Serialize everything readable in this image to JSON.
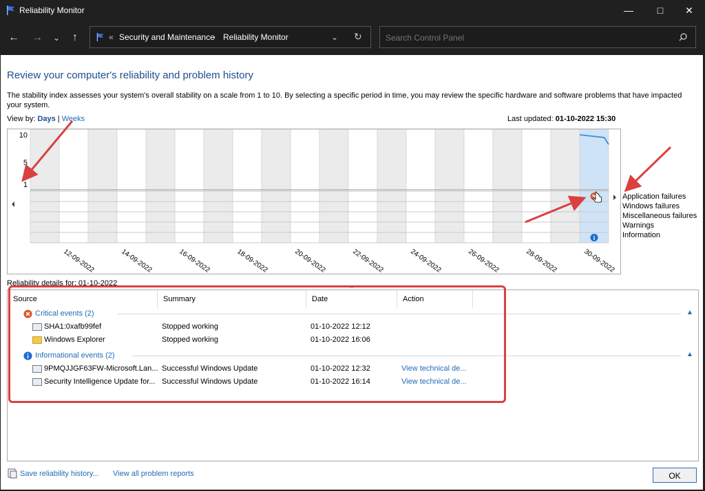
{
  "window": {
    "title": "Reliability Monitor"
  },
  "address": {
    "prefix": "«",
    "crumbs": [
      "Security and Maintenance",
      "Reliability Monitor"
    ]
  },
  "search": {
    "placeholder": "Search Control Panel"
  },
  "page": {
    "heading": "Review your computer's reliability and problem history",
    "description": "The stability index assesses your system's overall stability on a scale from 1 to 10. By selecting a specific period in time, you may review the specific hardware and software problems that have impacted your system.",
    "view_by_label": "View by:",
    "view_days": "Days",
    "view_separator": "|",
    "view_weeks": "Weeks",
    "last_updated_label": "Last updated:",
    "last_updated_value": "01-10-2022 15:30"
  },
  "chart_data": {
    "type": "line",
    "y_ticks": [
      "10",
      "5",
      "1"
    ],
    "ylim": [
      1,
      10
    ],
    "dates": [
      "12-09-2022",
      "14-09-2022",
      "16-09-2022",
      "18-09-2022",
      "20-09-2022",
      "22-09-2022",
      "24-09-2022",
      "26-09-2022",
      "28-09-2022",
      "30-09-2022"
    ],
    "stability_index": {
      "x": [
        "01-10-2022",
        "01-10-2022"
      ],
      "y": [
        10,
        9.5
      ]
    },
    "selected_day": "01-10-2022",
    "events": [
      {
        "day": "01-10-2022",
        "category": "Application failures",
        "kind": "critical"
      },
      {
        "day": "01-10-2022",
        "category": "Information",
        "kind": "info"
      }
    ],
    "grid": true
  },
  "legend": [
    "Application failures",
    "Windows failures",
    "Miscellaneous failures",
    "Warnings",
    "Information"
  ],
  "details": {
    "label": "Reliability details for: 01-10-2022",
    "columns": [
      "Source",
      "Summary",
      "Date",
      "Action"
    ],
    "groups": [
      {
        "title": "Critical events (2)",
        "rows": [
          {
            "source": "SHA1:0xafb99fef",
            "summary": "Stopped working",
            "date": "01-10-2022 12:12",
            "action": ""
          },
          {
            "source": "Windows Explorer",
            "summary": "Stopped working",
            "date": "01-10-2022 16:06",
            "action": ""
          }
        ]
      },
      {
        "title": "Informational events (2)",
        "rows": [
          {
            "source": "9PMQJJGF63FW-Microsoft.Lan...",
            "summary": "Successful Windows Update",
            "date": "01-10-2022 12:32",
            "action": "View technical de..."
          },
          {
            "source": "Security Intelligence Update for...",
            "summary": "Successful Windows Update",
            "date": "01-10-2022 16:14",
            "action": "View technical de..."
          }
        ]
      }
    ]
  },
  "footer": {
    "save": "Save reliability history...",
    "view_all": "View all problem reports",
    "ok": "OK"
  },
  "colors": {
    "accent": "#1e6bb8",
    "selected": "#cfe3f7",
    "critical": "#d9572b",
    "info": "#1e6bd0",
    "annotation": "#d94040"
  }
}
